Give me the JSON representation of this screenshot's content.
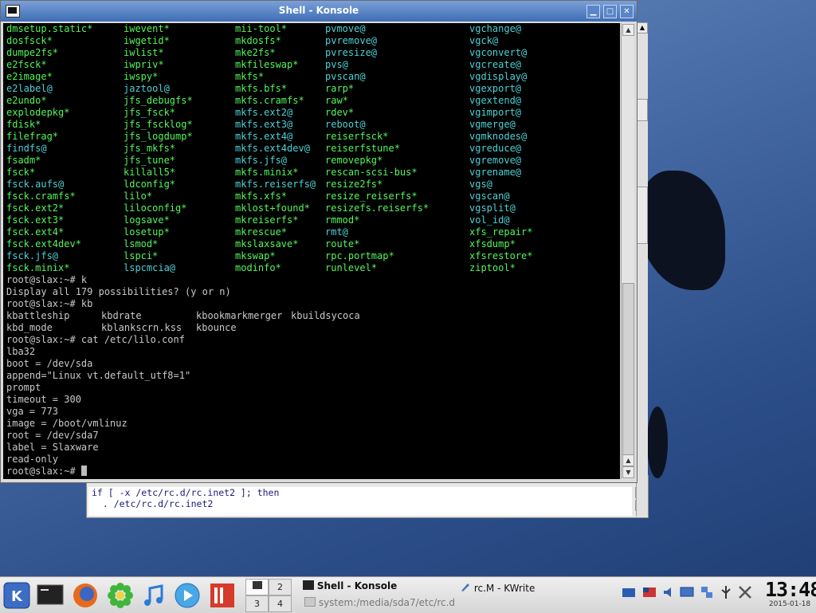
{
  "konsole": {
    "title": "Shell - Konsole",
    "buttons": {
      "minimize": "▁",
      "maximize": "□",
      "close": "✕"
    },
    "listing": [
      [
        "dmsetup.static*",
        "iwevent*",
        "mii-tool*",
        "pvmove@",
        "vgchange@"
      ],
      [
        "dosfsck*",
        "iwgetid*",
        "mkdosfs*",
        "pvremove@",
        "vgck@"
      ],
      [
        "dumpe2fs*",
        "iwlist*",
        "mke2fs*",
        "pvresize@",
        "vgconvert@"
      ],
      [
        "e2fsck*",
        "iwpriv*",
        "mkfileswap*",
        "pvs@",
        "vgcreate@"
      ],
      [
        "e2image*",
        "iwspy*",
        "mkfs*",
        "pvscan@",
        "vgdisplay@"
      ],
      [
        "e2label@",
        "jaztool@",
        "mkfs.bfs*",
        "rarp*",
        "vgexport@"
      ],
      [
        "e2undo*",
        "jfs_debugfs*",
        "mkfs.cramfs*",
        "raw*",
        "vgextend@"
      ],
      [
        "explodepkg*",
        "jfs_fsck*",
        "mkfs.ext2@",
        "rdev*",
        "vgimport@"
      ],
      [
        "fdisk*",
        "jfs_fscklog*",
        "mkfs.ext3@",
        "reboot@",
        "vgmerge@"
      ],
      [
        "filefrag*",
        "jfs_logdump*",
        "mkfs.ext4@",
        "reiserfsck*",
        "vgmknodes@"
      ],
      [
        "findfs@",
        "jfs_mkfs*",
        "mkfs.ext4dev@",
        "reiserfstune*",
        "vgreduce@"
      ],
      [
        "fsadm*",
        "jfs_tune*",
        "mkfs.jfs@",
        "removepkg*",
        "vgremove@"
      ],
      [
        "fsck*",
        "killall5*",
        "mkfs.minix*",
        "rescan-scsi-bus*",
        "vgrename@"
      ],
      [
        "fsck.aufs@",
        "ldconfig*",
        "mkfs.reiserfs@",
        "resize2fs*",
        "vgs@"
      ],
      [
        "fsck.cramfs*",
        "lilo*",
        "mkfs.xfs*",
        "resize_reiserfs*",
        "vgscan@"
      ],
      [
        "fsck.ext2*",
        "liloconfig*",
        "mklost+found*",
        "resizefs.reiserfs*",
        "vgsplit@"
      ],
      [
        "fsck.ext3*",
        "logsave*",
        "mkreiserfs*",
        "rmmod*",
        "vol_id@"
      ],
      [
        "fsck.ext4*",
        "losetup*",
        "mkrescue*",
        "rmt@",
        "xfs_repair*"
      ],
      [
        "fsck.ext4dev*",
        "lsmod*",
        "mkslaxsave*",
        "route*",
        "xfsdump*"
      ],
      [
        "fsck.jfs@",
        "lspci*",
        "mkswap*",
        "rpc.portmap*",
        "xfsrestore*"
      ],
      [
        "fsck.minix*",
        "lspcmcia@",
        "modinfo*",
        "runlevel*",
        "ziptool*"
      ]
    ],
    "session": [
      "root@slax:~# k",
      "Display all 179 possibilities? (y or n)",
      "root@slax:~# kb"
    ],
    "kb_completions": [
      [
        "kbattleship",
        "kbdrate",
        "kbookmarkmerger",
        "kbuildsycoca"
      ],
      [
        "kbd_mode",
        "kblankscrn.kss",
        "kbounce"
      ]
    ],
    "output": [
      "root@slax:~# cat /etc/lilo.conf",
      "lba32",
      "boot = /dev/sda",
      "append=\"Linux vt.default_utf8=1\"",
      "prompt",
      "timeout = 300",
      "vga = 773",
      "image = /boot/vmlinuz",
      "root = /dev/sda7",
      "label = Slaxware",
      "read-only"
    ],
    "prompt": "root@slax:~# "
  },
  "kwrite": {
    "lines": [
      "if [ -x /etc/rc.d/rc.inet2 ]; then",
      "  . /etc/rc.d/rc.inet2"
    ]
  },
  "taskbar": {
    "launchers": [
      "kde-menu-icon",
      "terminal-icon",
      "firefox-icon",
      "icq-icon",
      "music-player-icon",
      "media-player-icon",
      "office-icon"
    ],
    "pager": [
      "2",
      "3",
      "4"
    ],
    "tasks": [
      {
        "label": "Shell - Konsole",
        "sub": "system:/media/sda7/etc/rc.d"
      },
      {
        "label": "rc.M - KWrite"
      }
    ],
    "tray": [
      "volume-icon",
      "display-icon",
      "network-icon",
      "usb-icon",
      "wifi-icon",
      "tools-icon"
    ],
    "clock": {
      "time": "13:48",
      "date": "2015-01-18"
    }
  }
}
